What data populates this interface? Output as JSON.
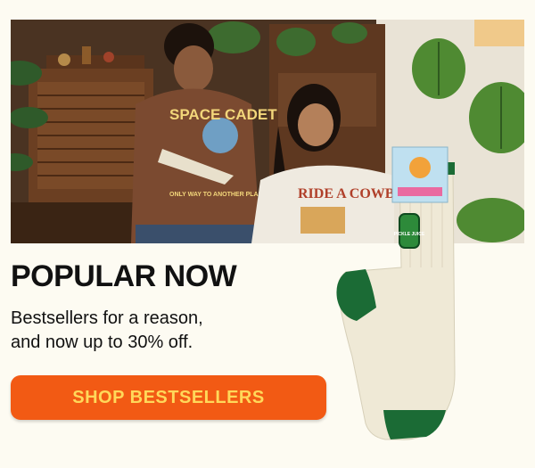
{
  "hero": {
    "shirt_left_text": "SPACE CADET",
    "shirt_left_caption": "ONLY WAY TO ANOTHER PLANET",
    "shirt_right_text": "RIDE A COWBOY"
  },
  "headline": "POPULAR NOW",
  "subtext": {
    "line1": "Bestsellers for a reason,",
    "line2": "and now up to 30% off."
  },
  "cta": {
    "label": "SHOP BESTSELLERS"
  },
  "sock": {
    "patch_text": "PICKLE JUICE"
  },
  "colors": {
    "background": "#fdfbf2",
    "cta_background": "#f25a14",
    "cta_text": "#ffd85a",
    "sock_accent": "#1b6b35",
    "sock_body": "#efe9d6"
  }
}
